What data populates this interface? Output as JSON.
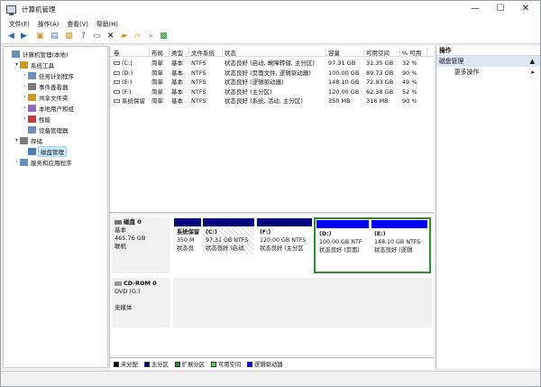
{
  "window": {
    "title": "计算机管理"
  },
  "titlebar_buttons": {
    "minimize": "—",
    "maximize": "☐",
    "close": "✕"
  },
  "menu": [
    "文件(F)",
    "操作(A)",
    "查看(V)",
    "帮助(H)"
  ],
  "tree": [
    {
      "label": "计算机管理(本地)",
      "level": 0,
      "expander": "",
      "icon": "computer-icon",
      "selected": false
    },
    {
      "label": "系统工具",
      "level": 1,
      "expander": "▾",
      "icon": "tools-icon",
      "selected": false
    },
    {
      "label": "任务计划程序",
      "level": 2,
      "expander": "›",
      "icon": "clock-icon",
      "selected": false
    },
    {
      "label": "事件查看器",
      "level": 2,
      "expander": "›",
      "icon": "event-viewer-icon",
      "selected": false
    },
    {
      "label": "共享文件夹",
      "level": 2,
      "expander": "›",
      "icon": "shared-folder-icon",
      "selected": false
    },
    {
      "label": "本地用户和组",
      "level": 2,
      "expander": "›",
      "icon": "users-icon",
      "selected": false
    },
    {
      "label": "性能",
      "level": 2,
      "expander": "›",
      "icon": "performance-icon",
      "selected": false
    },
    {
      "label": "设备管理器",
      "level": 2,
      "expander": "",
      "icon": "device-manager-icon",
      "selected": false
    },
    {
      "label": "存储",
      "level": 1,
      "expander": "▾",
      "icon": "storage-icon",
      "selected": false
    },
    {
      "label": "磁盘管理",
      "level": 2,
      "expander": "",
      "icon": "disk-management-icon",
      "selected": true
    },
    {
      "label": "服务和应用程序",
      "level": 1,
      "expander": "›",
      "icon": "services-icon",
      "selected": false
    }
  ],
  "volume_table": {
    "headers": [
      "卷",
      "布局",
      "类型",
      "文件系统",
      "状态",
      "容量",
      "可用空间",
      "% 可用"
    ],
    "rows": [
      [
        "(C:)",
        "简单",
        "基本",
        "NTFS",
        "状态良好 (启动, 故障转储, 主分区)",
        "97.31 GB",
        "31.35 GB",
        "32 %"
      ],
      [
        "(D:)",
        "简单",
        "基本",
        "NTFS",
        "状态良好 (页面文件, 逻辑驱动器)",
        "100.00 GB",
        "89.73 GB",
        "90 %"
      ],
      [
        "(E:)",
        "简单",
        "基本",
        "NTFS",
        "状态良好 (逻辑驱动器)",
        "148.10 GB",
        "72.93 GB",
        "49 %"
      ],
      [
        "(F:)",
        "简单",
        "基本",
        "NTFS",
        "状态良好 (主分区)",
        "120.00 GB",
        "62.38 GB",
        "52 %"
      ],
      [
        "系统保留",
        "简单",
        "基本",
        "NTFS",
        "状态良好 (系统, 活动, 主分区)",
        "350 MB",
        "316 MB",
        "90 %"
      ]
    ]
  },
  "disks": [
    {
      "lines": [
        "磁盘 0",
        "基本",
        "465.76 GB",
        "联机"
      ],
      "partitions": [
        {
          "name": "系统保留",
          "size": "350 M",
          "status": "状态良",
          "type": "primary"
        },
        {
          "name": "(C:)",
          "size": "97.31 GB NTFS",
          "status": "状态良好 (启动,",
          "type": "primary"
        },
        {
          "name": "(F:)",
          "size": "120.00 GB NTFS",
          "status": "状态良好 (主分区",
          "type": "primary"
        },
        {
          "name": "(D:)",
          "size": "100.00 GB NTF",
          "status": "状态良好 (页面)",
          "type": "logical"
        },
        {
          "name": "(E:)",
          "size": "148.10 GB NTFS",
          "status": "状态良好 (逻辑",
          "type": "logical"
        }
      ]
    },
    {
      "lines": [
        "CD-ROM 0",
        "DVD (G:)",
        "",
        "无媒体"
      ]
    }
  ],
  "legend": [
    {
      "label": "未分配",
      "color": "#000000"
    },
    {
      "label": "主分区",
      "color": "#000080"
    },
    {
      "label": "扩展分区",
      "color": "#2e8b2e"
    },
    {
      "label": "可用空间",
      "color": "#55d455"
    },
    {
      "label": "逻辑驱动器",
      "color": "#0000ff"
    }
  ],
  "actions": {
    "header": "操作",
    "section": "磁盘管理",
    "more": "更多操作",
    "collapse_arrow": "▲",
    "more_arrow": "▸"
  },
  "colors": {
    "primary": "#000080",
    "logical": "#0000ff",
    "extended": "#2e8b2e",
    "selection": "#cde8ff"
  }
}
